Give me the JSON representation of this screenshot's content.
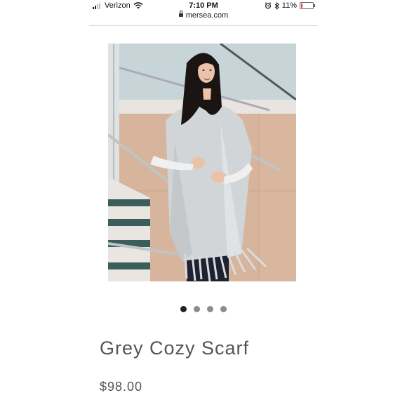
{
  "status_bar": {
    "carrier": "Verizon",
    "time": "7:10 PM",
    "battery_percent": "11%",
    "battery_level": 0.11,
    "icons": [
      "signal-icon",
      "wifi-icon",
      "alarm-icon",
      "bluetooth-icon",
      "battery-icon"
    ]
  },
  "browser": {
    "url": "mersea.com",
    "lock_icon": "lock-icon"
  },
  "product": {
    "title": "Grey Cozy Scarf",
    "price": "$98.00",
    "image": "woman-wearing-grey-scarf-photo"
  },
  "carousel": {
    "total": 4,
    "active_index": 0
  },
  "colors": {
    "text": "#555555",
    "dot_active": "#222222",
    "dot_inactive": "#8c8c8c",
    "battery_low": "#e53935"
  }
}
